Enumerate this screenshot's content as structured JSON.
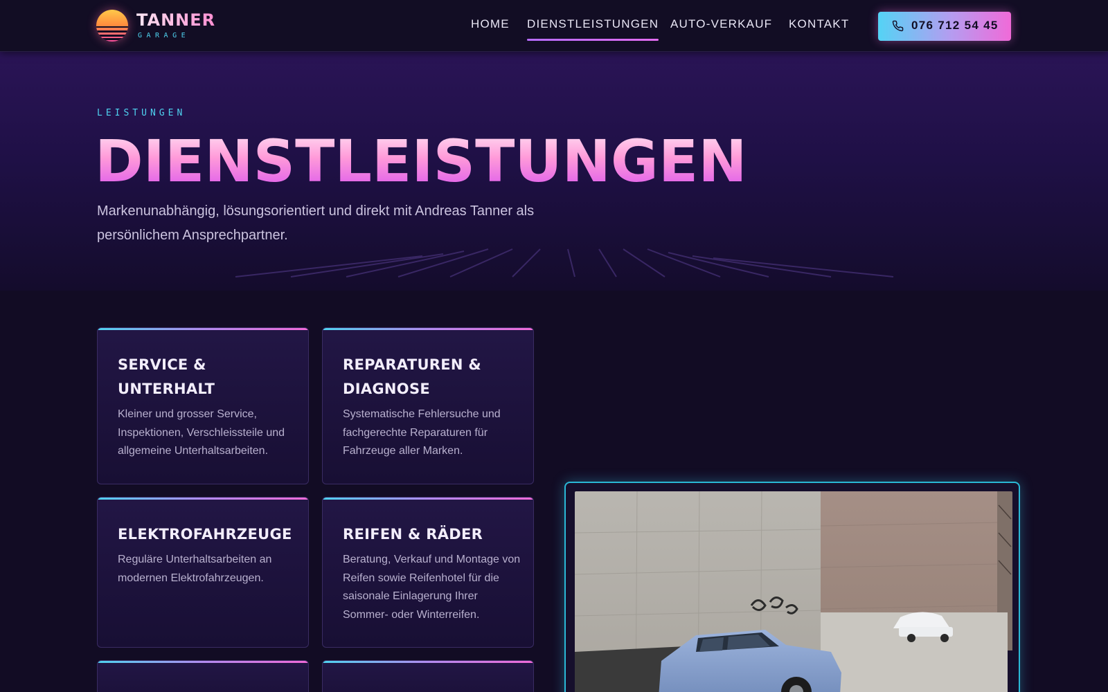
{
  "brand": {
    "name": "TANNER",
    "sub": "GARAGE"
  },
  "nav": {
    "items": [
      {
        "label": "HOME",
        "active": false
      },
      {
        "label": "DIENSTLEISTUNGEN",
        "active": true
      },
      {
        "label": "AUTO-VERKAUF",
        "active": false
      },
      {
        "label": "KONTAKT",
        "active": false
      }
    ],
    "phone": "076 712 54 45"
  },
  "hero": {
    "eyebrow": "LEISTUNGEN",
    "title": "DIENSTLEISTUNGEN",
    "description": "Markenunabhängig, lösungsorientiert und direkt mit Andreas Tanner als persönlichem Ansprechpartner."
  },
  "services": [
    {
      "title": "SERVICE & UNTERHALT",
      "description": "Kleiner und grosser Service, Inspektionen, Verschleissteile und allgemeine Unterhaltsarbeiten."
    },
    {
      "title": "REPARATUREN & DIAGNOSE",
      "description": "Systematische Fehlersuche und fachgerechte Reparaturen für Fahrzeuge aller Marken."
    },
    {
      "title": "ELEKTROFAHRZEUGE",
      "description": "Reguläre Unterhaltsarbeiten an modernen Elektrofahrzeugen."
    },
    {
      "title": "REIFEN & RÄDER",
      "description": "Beratung, Verkauf und Montage von Reifen sowie Reifenhotel für die saisonale Einlagerung Ihrer Sommer- oder Winterreifen."
    }
  ],
  "colors": {
    "background": "#120c24",
    "accent_cyan": "#4fd3f0",
    "accent_pink": "#f06ad8",
    "accent_purple": "#b66cff"
  },
  "icons": {
    "phone": "phone-icon",
    "logo": "sunset-logo-icon"
  }
}
